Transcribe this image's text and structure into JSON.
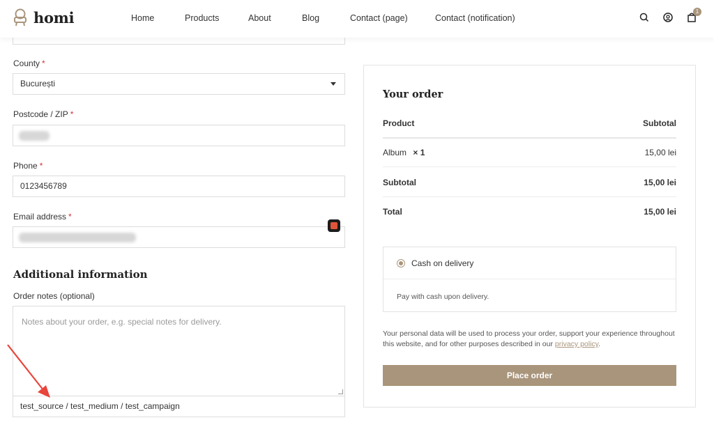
{
  "header": {
    "brand": "homi",
    "nav": [
      "Home",
      "Products",
      "About",
      "Blog",
      "Contact (page)",
      "Contact (notification)"
    ],
    "cart_count": "1"
  },
  "form": {
    "county_label": "County",
    "county_value": "București",
    "postcode_label": "Postcode / ZIP",
    "phone_label": "Phone",
    "phone_value": "0123456789",
    "email_label": "Email address",
    "required_mark": "*",
    "additional_title": "Additional information",
    "notes_label": "Order notes (optional)",
    "notes_placeholder": "Notes about your order, e.g. special notes for delivery.",
    "utm_value": "test_source / test_medium / test_campaign"
  },
  "order": {
    "title": "Your order",
    "col_product": "Product",
    "col_subtotal": "Subtotal",
    "item_name": "Album",
    "item_qty": "× 1",
    "item_total": "15,00 lei",
    "subtotal_label": "Subtotal",
    "subtotal_value": "15,00 lei",
    "total_label": "Total",
    "total_value": "15,00 lei",
    "payment_method": "Cash on delivery",
    "payment_desc": "Pay with cash upon delivery.",
    "privacy_text": "Your personal data will be used to process your order, support your experience throughout this website, and for other purposes described in our",
    "privacy_link": "privacy policy",
    "place_order": "Place order"
  },
  "colors": {
    "accent": "#a9957b",
    "required": "#d0353a",
    "arrow": "#e8453c"
  }
}
